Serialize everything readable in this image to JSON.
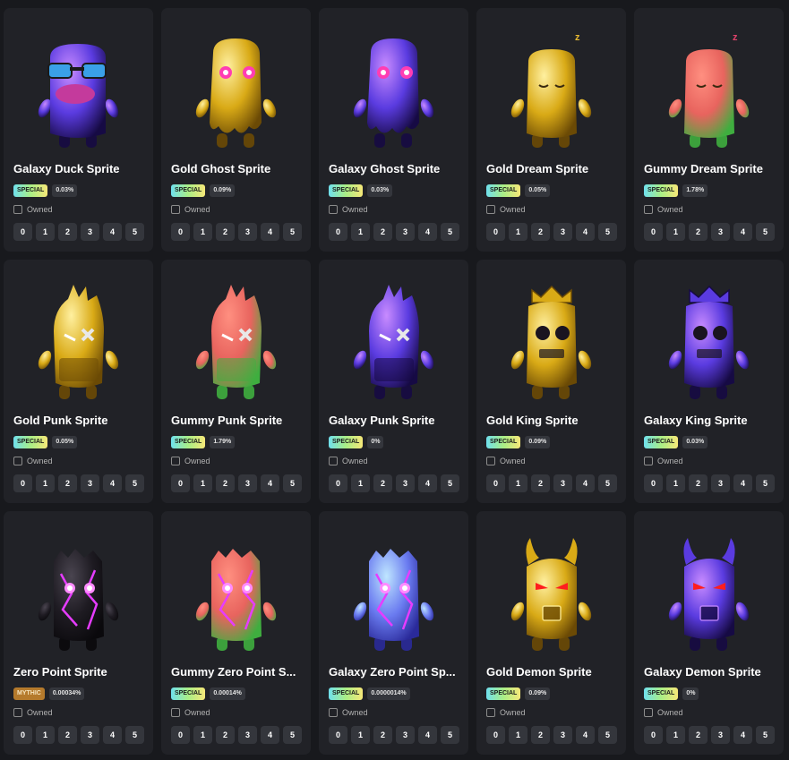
{
  "owned_label": "Owned",
  "levels": [
    "0",
    "1",
    "2",
    "3",
    "4",
    "5"
  ],
  "cards": [
    {
      "name": "Galaxy Duck Sprite",
      "rarity": "SPECIAL",
      "percent": "0.03%",
      "variant": "galaxy",
      "form": "duck",
      "glyph": ""
    },
    {
      "name": "Gold Ghost Sprite",
      "rarity": "SPECIAL",
      "percent": "0.09%",
      "variant": "gold",
      "form": "ghost",
      "glyph": ""
    },
    {
      "name": "Galaxy Ghost Sprite",
      "rarity": "SPECIAL",
      "percent": "0.03%",
      "variant": "galaxy",
      "form": "ghost",
      "glyph": ""
    },
    {
      "name": "Gold Dream Sprite",
      "rarity": "SPECIAL",
      "percent": "0.05%",
      "variant": "gold",
      "form": "dream",
      "glyph": "z"
    },
    {
      "name": "Gummy Dream Sprite",
      "rarity": "SPECIAL",
      "percent": "1.78%",
      "variant": "gummy",
      "form": "dream",
      "glyph": "z"
    },
    {
      "name": "Gold Punk Sprite",
      "rarity": "SPECIAL",
      "percent": "0.05%",
      "variant": "gold",
      "form": "punk",
      "glyph": ""
    },
    {
      "name": "Gummy Punk Sprite",
      "rarity": "SPECIAL",
      "percent": "1.79%",
      "variant": "gummy",
      "form": "punk",
      "glyph": ""
    },
    {
      "name": "Galaxy Punk Sprite",
      "rarity": "SPECIAL",
      "percent": "0%",
      "variant": "galaxy",
      "form": "punk",
      "glyph": ""
    },
    {
      "name": "Gold King Sprite",
      "rarity": "SPECIAL",
      "percent": "0.09%",
      "variant": "gold",
      "form": "king",
      "glyph": ""
    },
    {
      "name": "Galaxy King Sprite",
      "rarity": "SPECIAL",
      "percent": "0.03%",
      "variant": "galaxy",
      "form": "king",
      "glyph": ""
    },
    {
      "name": "Zero Point Sprite",
      "rarity": "MYTHIC",
      "percent": "0.00034%",
      "variant": "zero",
      "form": "zeropoint",
      "glyph": ""
    },
    {
      "name": "Gummy Zero Point S...",
      "rarity": "SPECIAL",
      "percent": "0.00014%",
      "variant": "gummy",
      "form": "zeropoint",
      "glyph": ""
    },
    {
      "name": "Galaxy Zero Point Sp...",
      "rarity": "SPECIAL",
      "percent": "0.0000014%",
      "variant": "galaxyblue",
      "form": "zeropoint",
      "glyph": ""
    },
    {
      "name": "Gold Demon Sprite",
      "rarity": "SPECIAL",
      "percent": "0.09%",
      "variant": "gold",
      "form": "demon",
      "glyph": ""
    },
    {
      "name": "Galaxy Demon Sprite",
      "rarity": "SPECIAL",
      "percent": "0%",
      "variant": "galaxy",
      "form": "demon",
      "glyph": ""
    }
  ]
}
